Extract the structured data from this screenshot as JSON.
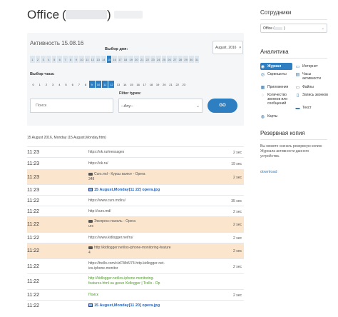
{
  "header": {
    "title": "Office",
    "paren_open": "(",
    "paren_close": ")"
  },
  "filters": {
    "activity_date": "Активность 15.08.16",
    "day_label": "Выбор дня:",
    "month_value": "August, 2016",
    "days": [
      "1",
      "2",
      "3",
      "4",
      "5",
      "6",
      "7",
      "8",
      "9",
      "10",
      "11",
      "12",
      "13",
      "14",
      "15",
      "16",
      "17",
      "18",
      "19",
      "20",
      "21",
      "22",
      "23",
      "24",
      "25",
      "26",
      "27",
      "28",
      "29",
      "30",
      "31"
    ],
    "selected_day": "15",
    "hour_label": "Выбор часа:",
    "hours": [
      "0",
      "1",
      "2",
      "3",
      "4",
      "5",
      "6",
      "7",
      "8",
      "9",
      "10",
      "11",
      "12",
      "13",
      "14",
      "15",
      "16",
      "17",
      "18",
      "19",
      "20",
      "21",
      "22",
      "23"
    ],
    "selected_hours": [
      "9",
      "10",
      "11",
      "12"
    ],
    "filter_types_label": "Filter types:",
    "search_placeholder": "Поиск",
    "type_value": "--Any--",
    "go_label": "GO"
  },
  "log": {
    "header": "15 August 2016, Monday (15 August,Monday.htm)",
    "rows": [
      {
        "time": "11:23",
        "text": "https://ok.ru/messages",
        "dur": "2 sec",
        "kind": "url",
        "hl": false
      },
      {
        "time": "11:23",
        "text": "https://ok.ru/",
        "dur": "19 sec",
        "kind": "url",
        "hl": false
      },
      {
        "time": "11:23",
        "text": "Curs.md - Курсы валют - Opera",
        "text2": "348",
        "dur": "2 sec",
        "kind": "app",
        "hl": true
      },
      {
        "time": "11:23",
        "text": "15 August,Monday[11 22] opera.jpg",
        "dur": "",
        "kind": "shot",
        "hl": false
      },
      {
        "time": "11:22",
        "text": "https://www.curs.md/ru/",
        "dur": "35 sec",
        "kind": "url",
        "hl": false
      },
      {
        "time": "11:22",
        "text": "http://curs.md/",
        "dur": "2 sec",
        "kind": "url",
        "hl": false
      },
      {
        "time": "11:22",
        "text": "Экспресс-панель - Opera",
        "text2": "urs",
        "dur": "2 sec",
        "kind": "app",
        "hl": true
      },
      {
        "time": "11:22",
        "text": "https://www.kidlogger.net/ru/",
        "dur": "2 sec",
        "kind": "url",
        "hl": false
      },
      {
        "time": "11:22",
        "text": "http://kidlogger.net/ios-iphone-monitoring-feature",
        "text2": "4",
        "dur": "2 sec",
        "kind": "app",
        "hl": true
      },
      {
        "time": "11:22",
        "text": "https://trello.com/c/zFWb5/74-http-kidlogger-net-",
        "text2": "ios-iphone-monitor",
        "dur": "2 sec",
        "kind": "url",
        "hl": false
      },
      {
        "time": "11:22",
        "text": "http://kidlogger.net/ios-iphone-monitoring-",
        "text2": "features.html на доске Kidlogger | Trello - Op",
        "dur": "",
        "kind": "green",
        "hl": false
      },
      {
        "time": "11:22",
        "text": "Поиск",
        "dur": "2 sec",
        "kind": "green",
        "hl": false
      },
      {
        "time": "11:22",
        "text": "15 August,Monday[11 20] opera.jpg",
        "dur": "",
        "kind": "shot",
        "hl": false
      }
    ]
  },
  "sidebar": {
    "employees_heading": "Сотрудники",
    "employee_value": "Office (",
    "employee_value_end": ")",
    "analytics_heading": "Аналитика",
    "nav": [
      {
        "label": "Журнал",
        "icon": "journal-icon",
        "glyph": "◉",
        "active": true
      },
      {
        "label": "Интернет",
        "icon": "monitor-icon",
        "glyph": "▭",
        "active": false
      },
      {
        "label": "Скриншоты",
        "icon": "screenshot-icon",
        "glyph": "◎",
        "active": false
      },
      {
        "label": "Часы активности",
        "icon": "clock-icon",
        "glyph": "▤",
        "active": false
      },
      {
        "label": "Приложения",
        "icon": "apps-icon",
        "glyph": "▦",
        "active": false
      },
      {
        "label": "Файлы",
        "icon": "files-icon",
        "glyph": "▭",
        "active": false
      },
      {
        "label": "Количество звонков или сообщений",
        "icon": "chat-icon",
        "glyph": "◌",
        "active": false
      },
      {
        "label": "Запись звонков",
        "icon": "phone-icon",
        "glyph": "▯",
        "active": false
      },
      {
        "label": "Текст",
        "icon": "text-icon",
        "glyph": "▬",
        "active": false
      },
      {
        "label": "Карты",
        "icon": "map-pin-icon",
        "glyph": "◍",
        "active": false
      }
    ],
    "backup_heading": "Резервная копия",
    "backup_text": "Вы можете скачать резервную копию Журнала активности данного устройства.",
    "download_label": "download"
  }
}
